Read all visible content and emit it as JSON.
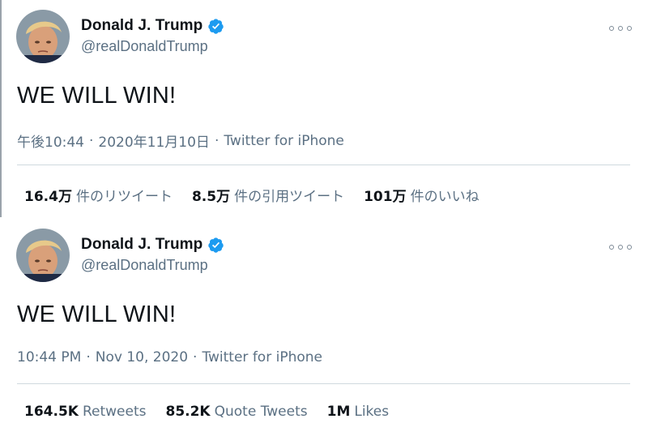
{
  "tweets": [
    {
      "display_name": "Donald J. Trump",
      "handle": "@realDonaldTrump",
      "text": "WE WILL WIN!",
      "time": "午後10:44",
      "date": "2020年11月10日",
      "separator": "·",
      "source": "Twitter for iPhone",
      "stats": [
        {
          "num": "16.4万",
          "label": "件のリツイート"
        },
        {
          "num": "8.5万",
          "label": "件の引用ツイート"
        },
        {
          "num": "101万",
          "label": "件のいいね"
        }
      ]
    },
    {
      "display_name": "Donald J. Trump",
      "handle": "@realDonaldTrump",
      "text": "WE WILL WIN!",
      "time": "10:44 PM",
      "date": "Nov 10, 2020",
      "separator": "·",
      "source": "Twitter for iPhone",
      "stats": [
        {
          "num": "164.5K",
          "label": "Retweets"
        },
        {
          "num": "85.2K",
          "label": "Quote Tweets"
        },
        {
          "num": "1M",
          "label": "Likes"
        }
      ]
    }
  ],
  "icons": {
    "verified": "verified-badge-icon",
    "more": "more-options-icon",
    "avatar": "profile-avatar"
  },
  "colors": {
    "verified_blue": "#1d9bf0",
    "secondary_text": "#5b7083",
    "primary_text": "#0f1419",
    "divider": "#cfd9de"
  }
}
